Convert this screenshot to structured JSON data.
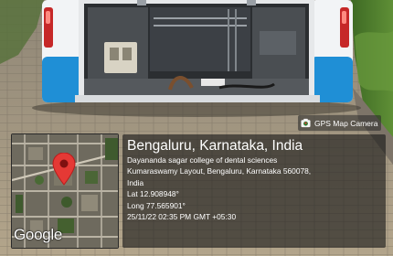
{
  "camera_badge": {
    "label": "GPS Map Camera",
    "icon": "gps-map-camera-icon"
  },
  "map_thumbnail": {
    "logo": "Google",
    "pin_icon": "map-pin-icon",
    "pin_color": "#e53935"
  },
  "location": {
    "title": "Bengaluru, Karnataka, India",
    "address_line_1": "Dayananda sagar college of dental sciences",
    "address_line_2": "Kumaraswamy Layout, Bengaluru, Karnataka 560078,",
    "address_line_3": "India",
    "latitude": "Lat 12.908948°",
    "longitude": "Long 77.565901°",
    "timestamp": "25/11/22 02:35 PM GMT +05:30"
  },
  "colors": {
    "bus_blue": "#1f8fd6",
    "bus_white": "#f2f4f6",
    "paver_tan": "#a89a80",
    "hedge_green": "#4d7a2c"
  }
}
